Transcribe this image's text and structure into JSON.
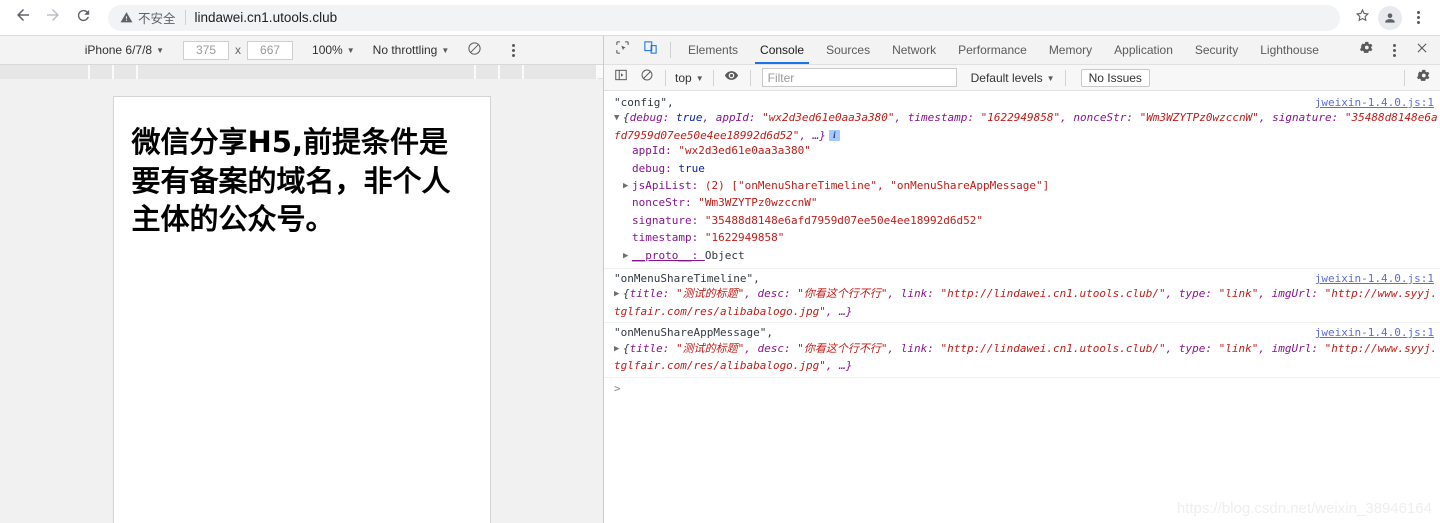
{
  "browser": {
    "back_icon": "back-arrow-icon",
    "forward_icon": "forward-arrow-icon",
    "reload_icon": "reload-icon",
    "security_label": "不安全",
    "url": "lindawei.cn1.utools.club",
    "bookmark_icon": "star-icon",
    "profile_icon": "profile-avatar-icon",
    "menu_icon": "kebab-menu-icon"
  },
  "device_toolbar": {
    "device": "iPhone 6/7/8",
    "width": "375",
    "height": "667",
    "times": "x",
    "zoom": "100%",
    "throttling": "No throttling",
    "rotate_icon": "rotate-device-icon",
    "more_icon": "kebab-menu-icon"
  },
  "page": {
    "heading": "微信分享H5,前提条件是要有备案的域名，非个人主体的公众号。"
  },
  "devtools": {
    "inspect_icon": "inspect-element-icon",
    "device_toggle_icon": "toggle-device-toolbar-icon",
    "tabs": [
      {
        "label": "Elements",
        "active": false
      },
      {
        "label": "Console",
        "active": true
      },
      {
        "label": "Sources",
        "active": false
      },
      {
        "label": "Network",
        "active": false
      },
      {
        "label": "Performance",
        "active": false
      },
      {
        "label": "Memory",
        "active": false
      },
      {
        "label": "Application",
        "active": false
      },
      {
        "label": "Security",
        "active": false
      },
      {
        "label": "Lighthouse",
        "active": false
      }
    ],
    "settings_icon": "gear-icon",
    "more_icon": "kebab-menu-icon",
    "close_icon": "close-icon"
  },
  "console_toolbar": {
    "sidebar_icon": "console-sidebar-icon",
    "clear_icon": "clear-console-icon",
    "context": "top",
    "eye_icon": "live-expression-eye-icon",
    "filter_placeholder": "Filter",
    "filter_value": "",
    "levels": "Default levels",
    "issues": "No Issues",
    "settings_icon": "gear-icon"
  },
  "console": {
    "messages": [
      {
        "source": "jweixin-1.4.0.js:1",
        "label": "\"config\",",
        "preview_prefix": "{",
        "preview_parts": [
          {
            "t": "debug: ",
            "c": "key"
          },
          {
            "t": "true",
            "c": "bool"
          },
          {
            "t": ", appId: ",
            "c": "key"
          },
          {
            "t": "\"wx2d3ed61e0aa3a380\"",
            "c": "str"
          },
          {
            "t": ", timestamp: ",
            "c": "key"
          },
          {
            "t": "\"1622949858\"",
            "c": "str"
          },
          {
            "t": ", nonceStr: ",
            "c": "key"
          },
          {
            "t": "\"Wm3WZYTPz0wzccnW\"",
            "c": "str"
          },
          {
            "t": ", signature: ",
            "c": "key"
          },
          {
            "t": "\"35488d8148e6afd7959d07ee50e4ee18992d6d52\"",
            "c": "str"
          },
          {
            "t": ", …}",
            "c": "key"
          }
        ],
        "expanded": true,
        "props": [
          {
            "key": "appId",
            "value": "\"wx2d3ed61e0aa3a380\"",
            "vclass": "str",
            "expandable": false
          },
          {
            "key": "debug",
            "value": "true",
            "vclass": "bool",
            "expandable": false
          },
          {
            "key": "jsApiList",
            "value": "(2) [\"onMenuShareTimeline\", \"onMenuShareAppMessage\"]",
            "vclass": "array",
            "expandable": true
          },
          {
            "key": "nonceStr",
            "value": "\"Wm3WZYTPz0wzccnW\"",
            "vclass": "str",
            "expandable": false
          },
          {
            "key": "signature",
            "value": "\"35488d8148e6afd7959d07ee50e4ee18992d6d52\"",
            "vclass": "str",
            "expandable": false
          },
          {
            "key": "timestamp",
            "value": "\"1622949858\"",
            "vclass": "str",
            "expandable": false
          },
          {
            "key": "__proto__",
            "value": "Object",
            "vclass": "plain",
            "expandable": true
          }
        ]
      },
      {
        "source": "jweixin-1.4.0.js:1",
        "label": "\"onMenuShareTimeline\",",
        "preview_prefix": "{",
        "preview_parts": [
          {
            "t": "title: ",
            "c": "key"
          },
          {
            "t": "\"测试的标题\"",
            "c": "str"
          },
          {
            "t": ", desc: ",
            "c": "key"
          },
          {
            "t": "\"你看这个行不行\"",
            "c": "str"
          },
          {
            "t": ", link: ",
            "c": "key"
          },
          {
            "t": "\"http://lindawei.cn1.utools.club/\"",
            "c": "str"
          },
          {
            "t": ", type: ",
            "c": "key"
          },
          {
            "t": "\"link\"",
            "c": "str"
          },
          {
            "t": ", imgUrl: ",
            "c": "key"
          },
          {
            "t": "\"http://www.syyj.tglfair.com/res/alibabalogo.jpg\"",
            "c": "str"
          },
          {
            "t": ", …}",
            "c": "key"
          }
        ],
        "expanded": false,
        "props": []
      },
      {
        "source": "jweixin-1.4.0.js:1",
        "label": "\"onMenuShareAppMessage\",",
        "preview_prefix": "{",
        "preview_parts": [
          {
            "t": "title: ",
            "c": "key"
          },
          {
            "t": "\"测试的标题\"",
            "c": "str"
          },
          {
            "t": ", desc: ",
            "c": "key"
          },
          {
            "t": "\"你看这个行不行\"",
            "c": "str"
          },
          {
            "t": ", link: ",
            "c": "key"
          },
          {
            "t": "\"http://lindawei.cn1.utools.club/\"",
            "c": "str"
          },
          {
            "t": ", type: ",
            "c": "key"
          },
          {
            "t": "\"link\"",
            "c": "str"
          },
          {
            "t": ", imgUrl: ",
            "c": "key"
          },
          {
            "t": "\"http://www.syyj.tglfair.com/res/alibabalogo.jpg\"",
            "c": "str"
          },
          {
            "t": ", …}",
            "c": "key"
          }
        ],
        "expanded": false,
        "props": []
      }
    ],
    "prompt": ">"
  },
  "watermark": "https://blog.csdn.net/weixin_38946164",
  "colors": {
    "accent": "#1a73e8",
    "string": "#c41a16",
    "key": "#881391",
    "number": "#1c00cf"
  }
}
